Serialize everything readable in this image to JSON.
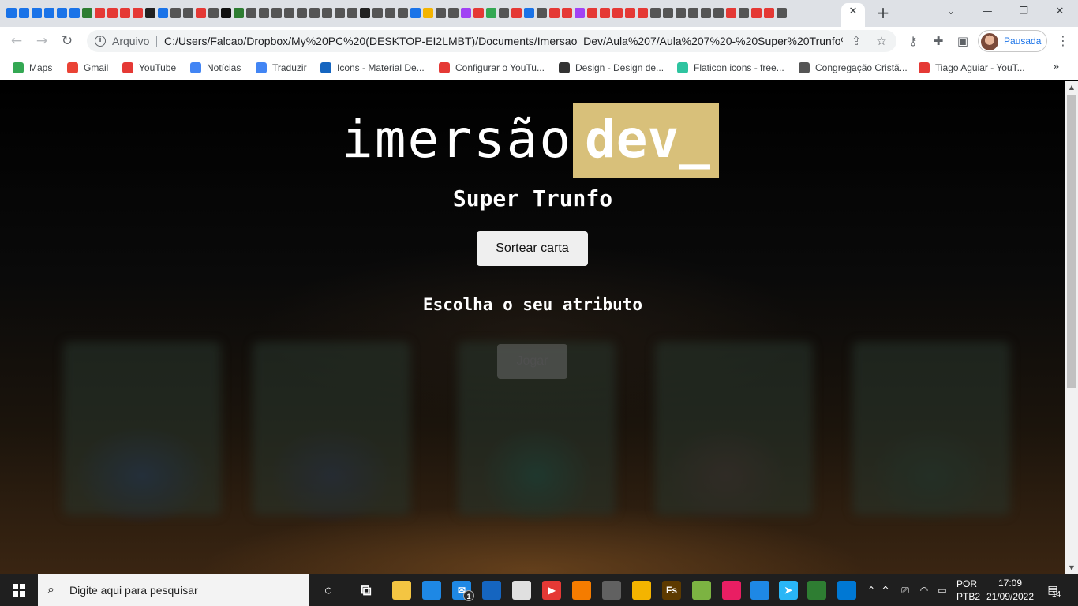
{
  "browser": {
    "tab_icon_colors": [
      "#1a73e8",
      "#1a73e8",
      "#1a73e8",
      "#1a73e8",
      "#1a73e8",
      "#1a73e8",
      "#2e7d32",
      "#e53935",
      "#e53935",
      "#e53935",
      "#e53935",
      "#222",
      "#1a73e8",
      "#555",
      "#555",
      "#e53935",
      "#555",
      "#111",
      "#2e7d32",
      "#555",
      "#555",
      "#555",
      "#555",
      "#555",
      "#555",
      "#555",
      "#555",
      "#555",
      "#222",
      "#555",
      "#555",
      "#555",
      "#1a73e8",
      "#f4b400",
      "#555",
      "#555",
      "#a142f4",
      "#e53935",
      "#34a853",
      "#555",
      "#e53935",
      "#1a73e8",
      "#555",
      "#e53935",
      "#e53935",
      "#a142f4",
      "#e53935",
      "#e53935",
      "#e53935",
      "#e53935",
      "#e53935",
      "#555",
      "#555",
      "#555",
      "#555",
      "#555",
      "#555",
      "#e53935",
      "#555",
      "#e53935",
      "#e53935",
      "#555"
    ],
    "close_tab_glyph": "✕",
    "new_tab_glyph": "+",
    "window_controls": {
      "dropdown": "⌄",
      "minimize": "—",
      "restore": "❐",
      "close": "✕"
    },
    "address_scheme": "Arquivo",
    "address_url": "C:/Users/Falcao/Dropbox/My%20PC%20(DESKTOP-EI2LMBT)/Documents/Imersao_Dev/Aula%207/Aula%207%20-%20Super%20Trunfo%2...",
    "profile_label": "Pausada",
    "bookmarks": [
      {
        "label": "Maps",
        "icon": "maps-icon",
        "color": "#34a853"
      },
      {
        "label": "Gmail",
        "icon": "gmail-icon",
        "color": "#ea4335"
      },
      {
        "label": "YouTube",
        "icon": "youtube-icon",
        "color": "#e53935"
      },
      {
        "label": "Notícias",
        "icon": "news-icon",
        "color": "#4285f4"
      },
      {
        "label": "Traduzir",
        "icon": "translate-icon",
        "color": "#4285f4"
      },
      {
        "label": "Icons - Material De...",
        "icon": "material-icon",
        "color": "#1565c0"
      },
      {
        "label": "Configurar o YouTu...",
        "icon": "youtube-icon",
        "color": "#e53935"
      },
      {
        "label": "Design - Design de...",
        "icon": "design-icon",
        "color": "#333"
      },
      {
        "label": "Flaticon icons - free...",
        "icon": "flaticon-icon",
        "color": "#2ec4a0"
      },
      {
        "label": "Congregação Cristã...",
        "icon": "globe-icon",
        "color": "#555"
      },
      {
        "label": "Tiago Aguiar - YouT...",
        "icon": "youtube-icon",
        "color": "#e53935"
      }
    ],
    "bookmarks_more": "»"
  },
  "page": {
    "logo_text": "imersão",
    "logo_highlight": "dev_",
    "logo_highlight_color": "#d8c07a",
    "title": "Super Trunfo",
    "draw_button": "Sortear carta",
    "subtitle": "Escolha o seu atributo",
    "play_button": "Jogar"
  },
  "taskbar": {
    "search_placeholder": "Digite aqui para pesquisar",
    "apps": [
      {
        "name": "cortana-icon",
        "glyph": "○",
        "color": "transparent"
      },
      {
        "name": "task-view-icon",
        "glyph": "⧉",
        "color": "transparent"
      },
      {
        "name": "file-explorer-icon",
        "glyph": "",
        "color": "#f4c542"
      },
      {
        "name": "store-icon",
        "glyph": "",
        "color": "#1e88e5"
      },
      {
        "name": "mail-icon",
        "glyph": "✉",
        "color": "#1e88e5"
      },
      {
        "name": "github-icon",
        "glyph": "",
        "color": "#1565c0"
      },
      {
        "name": "paint-icon",
        "glyph": "",
        "color": "#e0e0e0"
      },
      {
        "name": "youtube-icon",
        "glyph": "▶",
        "color": "#e53935"
      },
      {
        "name": "xampp-icon",
        "glyph": "",
        "color": "#f57c00"
      },
      {
        "name": "calculator-icon",
        "glyph": "",
        "color": "#616161"
      },
      {
        "name": "avatar-app-icon",
        "glyph": "",
        "color": "#f4b400"
      },
      {
        "name": "fireworks-icon",
        "glyph": "Fs",
        "color": "#5d3a00"
      },
      {
        "name": "3d-icon",
        "glyph": "",
        "color": "#7cb342"
      },
      {
        "name": "creative-cloud-icon",
        "glyph": "",
        "color": "#e91e63"
      },
      {
        "name": "network-app-icon",
        "glyph": "",
        "color": "#1e88e5"
      },
      {
        "name": "telegram-icon",
        "glyph": "➤",
        "color": "#29b6f6"
      },
      {
        "name": "evernote-icon",
        "glyph": "",
        "color": "#2e7d32"
      },
      {
        "name": "vscode-icon",
        "glyph": "",
        "color": "#0078d4"
      }
    ],
    "mail_badge": "1",
    "language_top": "POR",
    "language_bottom": "PTB2",
    "time": "17:09",
    "date": "21/09/2022",
    "notification_count": "14"
  }
}
